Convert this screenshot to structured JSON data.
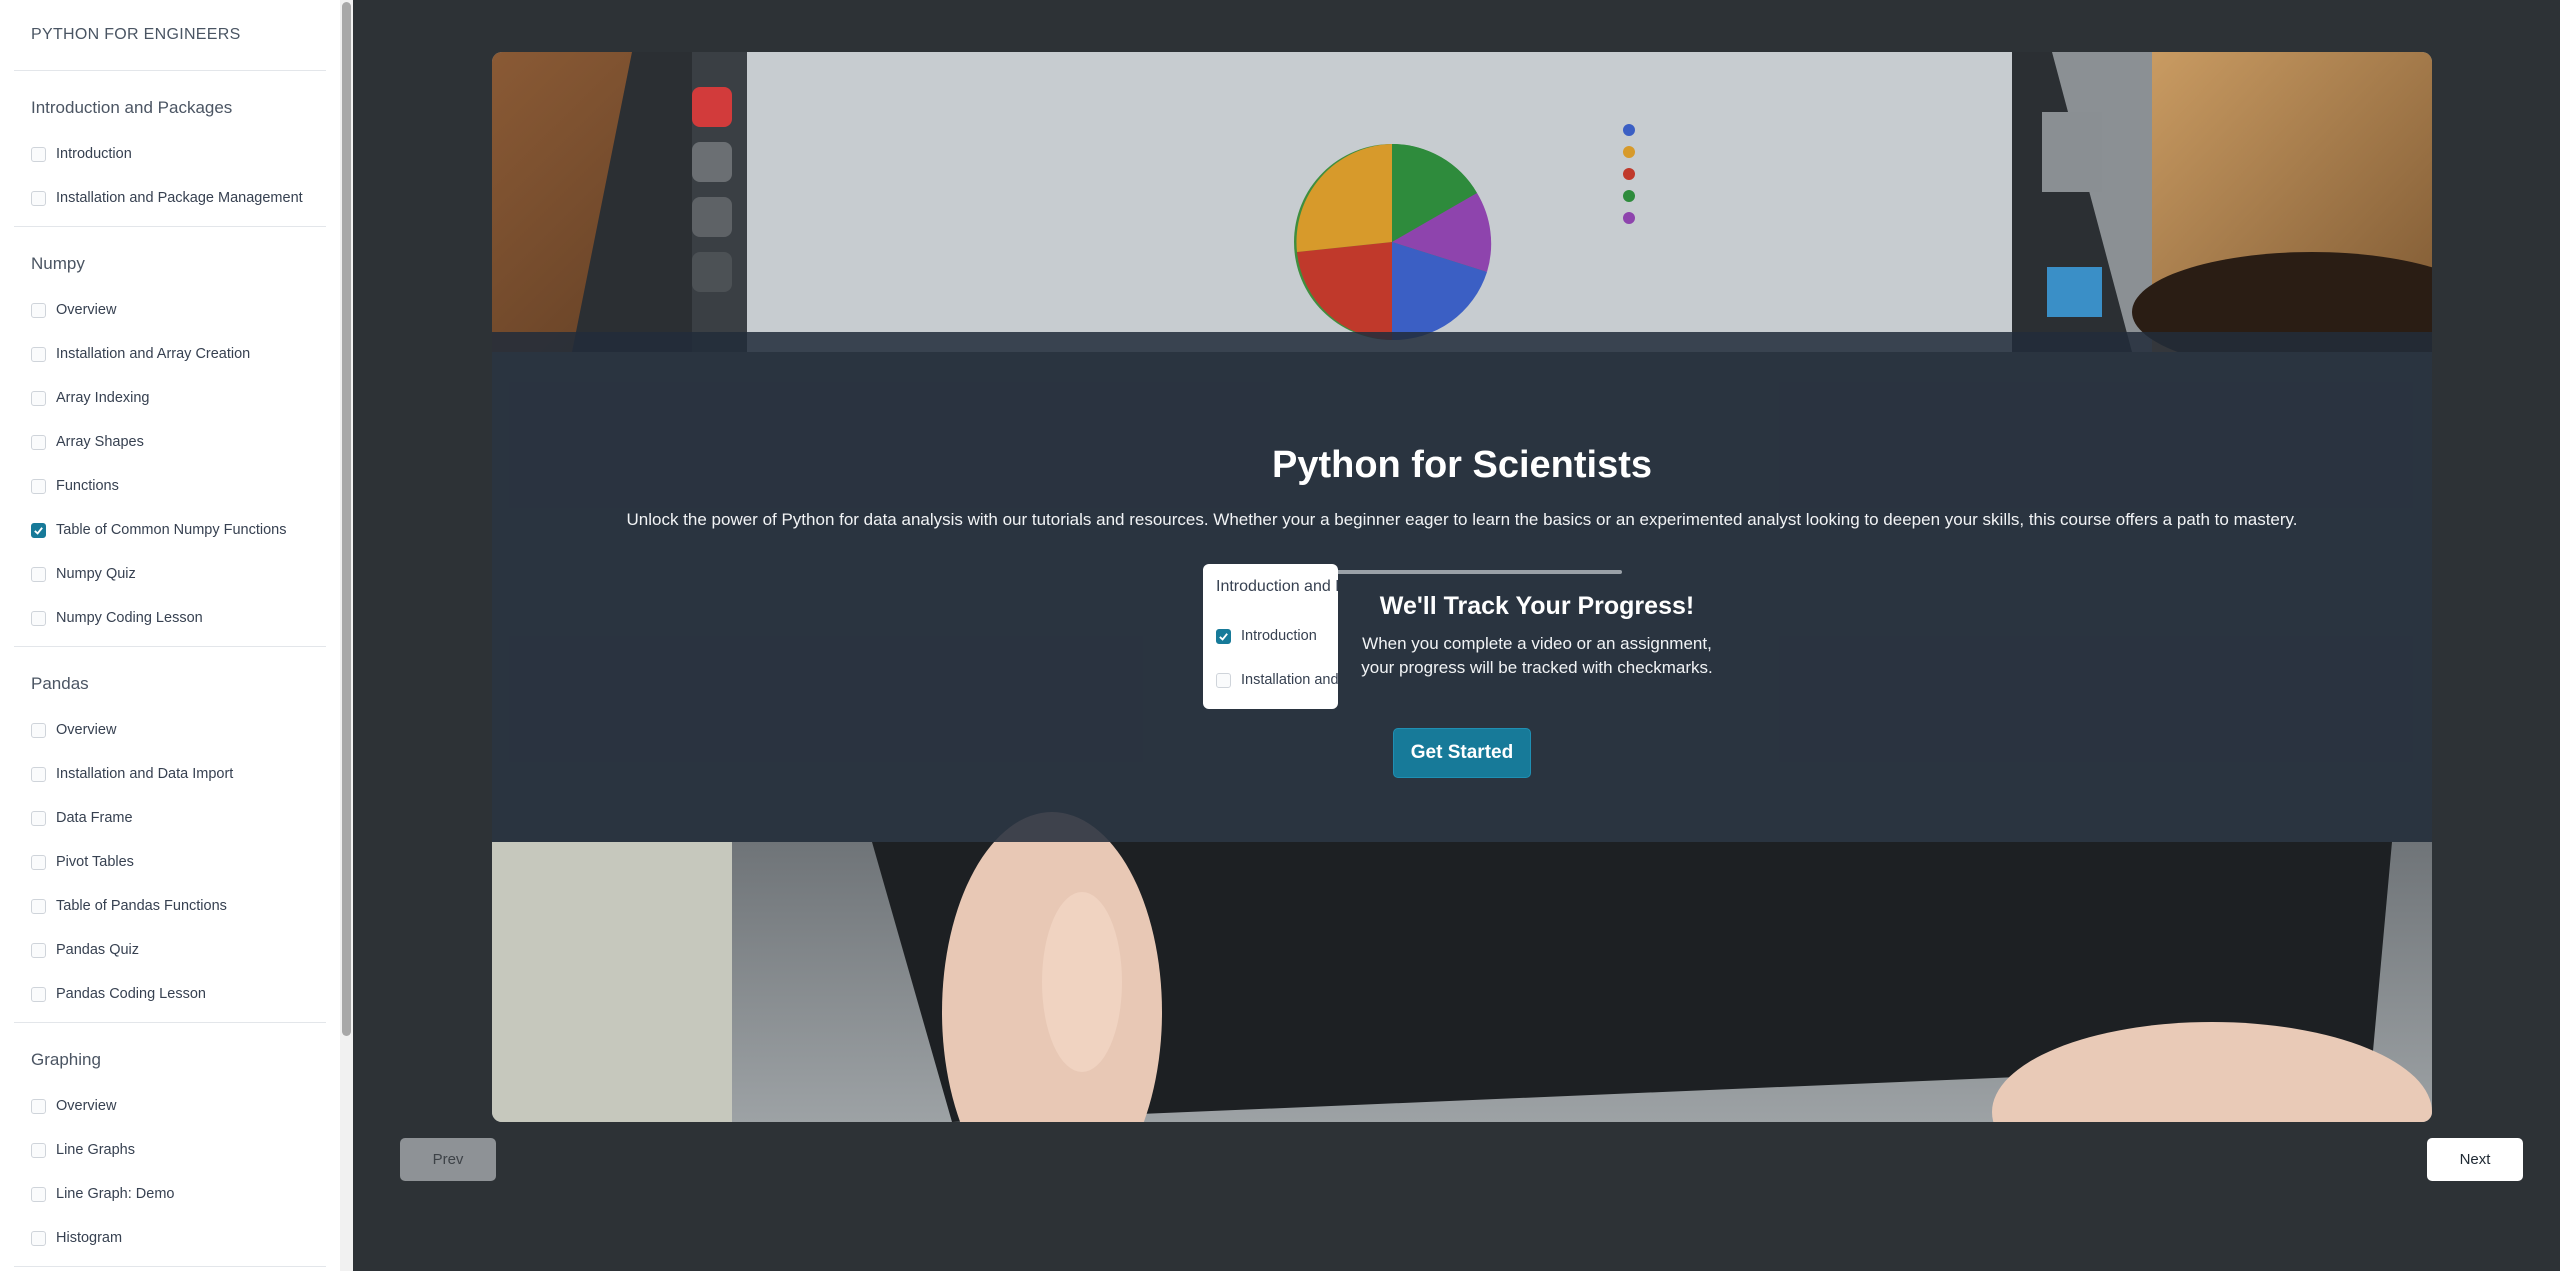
{
  "sidebar": {
    "course_title": "PYTHON FOR ENGINEERS",
    "sections": [
      {
        "title": "Introduction and Packages",
        "lessons": [
          {
            "label": "Introduction",
            "checked": false
          },
          {
            "label": "Installation and Package Management",
            "checked": false
          }
        ]
      },
      {
        "title": "Numpy",
        "lessons": [
          {
            "label": "Overview",
            "checked": false
          },
          {
            "label": "Installation and Array Creation",
            "checked": false
          },
          {
            "label": "Array Indexing",
            "checked": false
          },
          {
            "label": "Array Shapes",
            "checked": false
          },
          {
            "label": "Functions",
            "checked": false
          },
          {
            "label": "Table of Common Numpy Functions",
            "checked": true
          },
          {
            "label": "Numpy Quiz",
            "checked": false
          },
          {
            "label": "Numpy Coding Lesson",
            "checked": false
          }
        ]
      },
      {
        "title": "Pandas",
        "lessons": [
          {
            "label": "Overview",
            "checked": false
          },
          {
            "label": "Installation and Data Import",
            "checked": false
          },
          {
            "label": "Data Frame",
            "checked": false
          },
          {
            "label": "Pivot Tables",
            "checked": false
          },
          {
            "label": "Table of Pandas Functions",
            "checked": false
          },
          {
            "label": "Pandas Quiz",
            "checked": false
          },
          {
            "label": "Pandas Coding Lesson",
            "checked": false
          }
        ]
      },
      {
        "title": "Graphing",
        "lessons": [
          {
            "label": "Overview",
            "checked": false
          },
          {
            "label": "Line Graphs",
            "checked": false
          },
          {
            "label": "Line Graph: Demo",
            "checked": false
          },
          {
            "label": "Histogram",
            "checked": false
          }
        ]
      }
    ]
  },
  "hero": {
    "title": "Python for Scientists",
    "subtitle": "Unlock the power of Python for data analysis with our tutorials and resources. Whether your a beginner eager to learn the basics or an experimented analyst looking to deepen your skills, this course offers a path to mastery.",
    "demo": {
      "heading": "Introduction and Packages",
      "items": [
        {
          "label": "Introduction",
          "checked": true
        },
        {
          "label": "Installation and Package Management",
          "checked": false
        }
      ]
    },
    "track_title": "We'll Track Your Progress!",
    "track_text_line1": "When you complete a video or an assignment,",
    "track_text_line2": "your progress will be tracked with checkmarks.",
    "cta_label": "Get Started"
  },
  "nav": {
    "prev_label": "Prev",
    "next_label": "Next"
  },
  "colors": {
    "accent": "#177a99",
    "background": "#2d3236",
    "overlay": "#222c3a"
  }
}
